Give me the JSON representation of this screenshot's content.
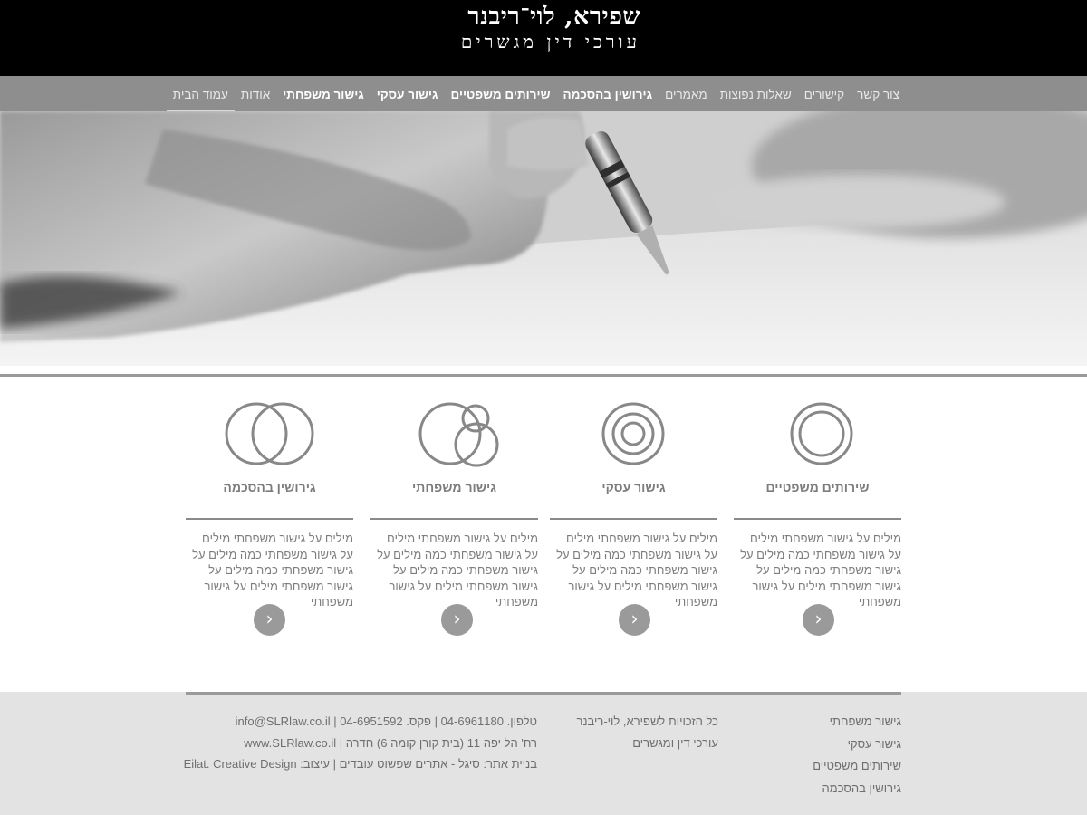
{
  "header": {
    "title": "שפירא, לוי־ריבנר",
    "subtitle": "עורכי דין מגשרים"
  },
  "nav": {
    "items": [
      {
        "label": "עמוד הבית",
        "active": true,
        "bold": false
      },
      {
        "label": "אודות",
        "active": false,
        "bold": false
      },
      {
        "label": "גישור משפחתי",
        "active": false,
        "bold": true
      },
      {
        "label": "גישור עסקי",
        "active": false,
        "bold": true
      },
      {
        "label": "שירותים משפטיים",
        "active": false,
        "bold": true
      },
      {
        "label": "גירושין בהסכמה",
        "active": false,
        "bold": true
      },
      {
        "label": "מאמרים",
        "active": false,
        "bold": false
      },
      {
        "label": "שאלות נפוצות",
        "active": false,
        "bold": false
      },
      {
        "label": "קישורים",
        "active": false,
        "bold": false
      },
      {
        "label": "צור קשר",
        "active": false,
        "bold": false
      }
    ]
  },
  "services": [
    {
      "title": "שירותים משפטיים",
      "text": "מילים על גישור משפחתי מילים על גישור משפחתי כמה מילים על גישור משפחתי כמה מילים על גישור משפחתי מילים על גישור משפחתי",
      "icon": "double-concentric-circles-icon"
    },
    {
      "title": "גישור עסקי",
      "text": "מילים על גישור משפחתי מילים על גישור משפחתי כמה מילים על גישור משפחתי כמה מילים על גישור משפחתי מילים על גישור משפחתי",
      "icon": "triple-concentric-circles-icon"
    },
    {
      "title": "גישור משפחתי",
      "text": "מילים על גישור משפחתי מילים על גישור משפחתי כמה מילים על גישור משפחתי כמה מילים על גישור משפחתי מילים על גישור משפחתי",
      "icon": "overlapping-three-circles-icon"
    },
    {
      "title": "גירושין בהסכמה",
      "text": "מילים על גישור משפחתי מילים על גישור משפחתי כמה מילים על גישור משפחתי כמה מילים על גישור משפחתי מילים על גישור משפחתי",
      "icon": "overlapping-two-circles-icon"
    }
  ],
  "more_button_glyph": "›",
  "footer": {
    "links": [
      "גישור משפחתי",
      "גישור עסקי",
      "שירותים משפטיים",
      "גירושין בהסכמה"
    ],
    "copyright": [
      "כל הזכויות לשפירא, לוי-ריבנר",
      "עורכי דין ומגשרים"
    ],
    "contact": [
      "טלפון. 04-6961180 | פקס. 04-6951592 | info@SLRlaw.co.il",
      "רח' הל יפה 11 (בית קורן קומה 6) חדרה | www.SLRlaw.co.il",
      "בניית אתר: סיגל - אתרים שפשוט עובדים | עיצוב: Eilat. Creative Design"
    ]
  },
  "colors": {
    "header_bg": "#000000",
    "nav_bg": "#8e8e8e",
    "footer_bg": "#e3e3e3",
    "button_bg": "#9a9a9a"
  }
}
